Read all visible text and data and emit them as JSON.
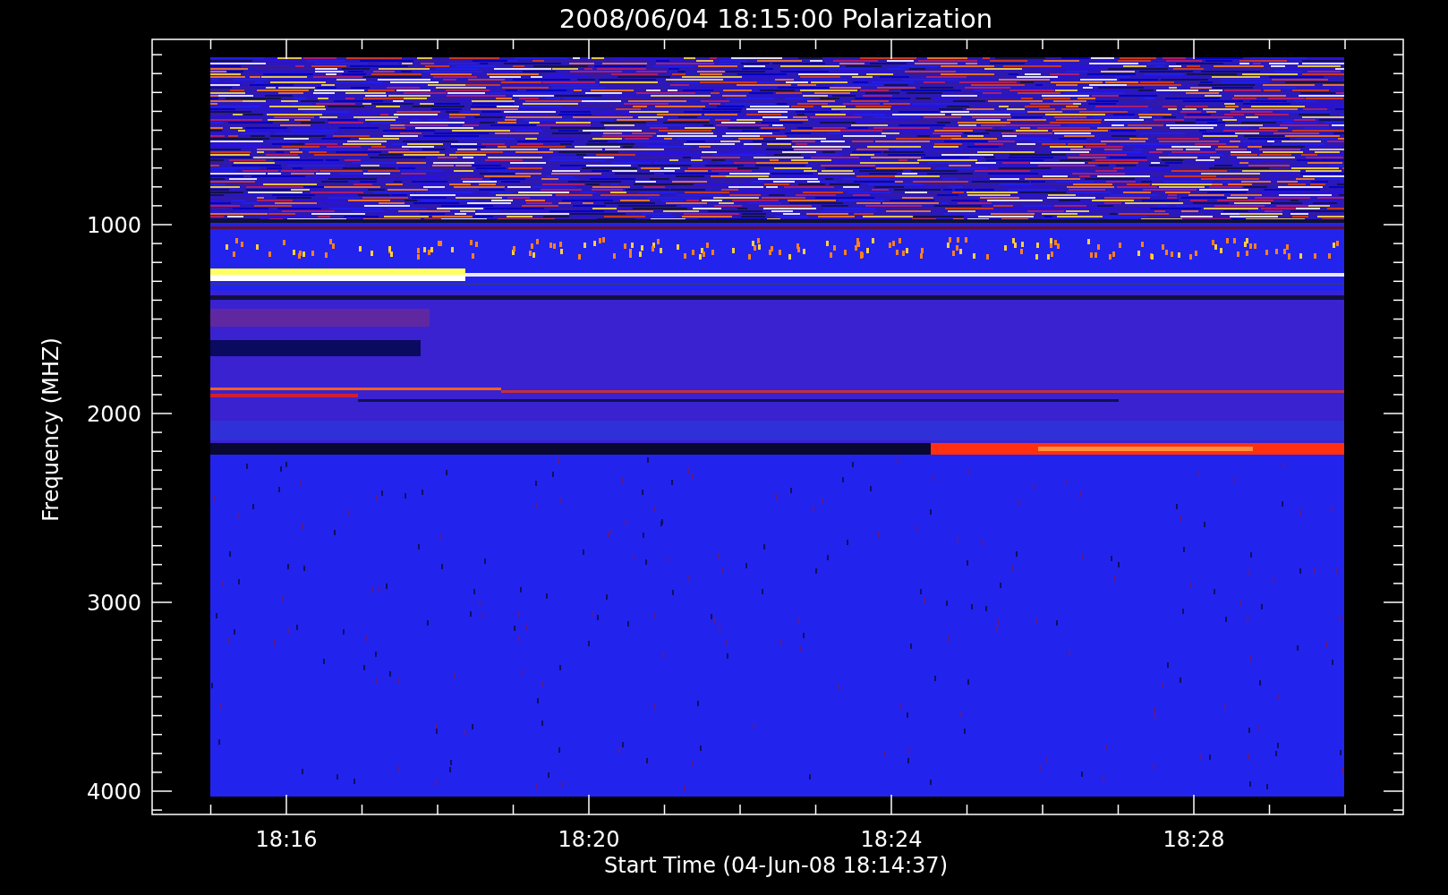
{
  "title": "2008/06/04 18:15:00 Polarization",
  "y_axis": {
    "label": "Frequency (MHZ)",
    "ticks": [
      "1000",
      "2000",
      "3000",
      "4000"
    ]
  },
  "x_axis": {
    "label": "Start Time (04-Jun-08 18:14:37)",
    "ticks": [
      "18:16",
      "18:20",
      "18:24",
      "18:28"
    ]
  }
}
